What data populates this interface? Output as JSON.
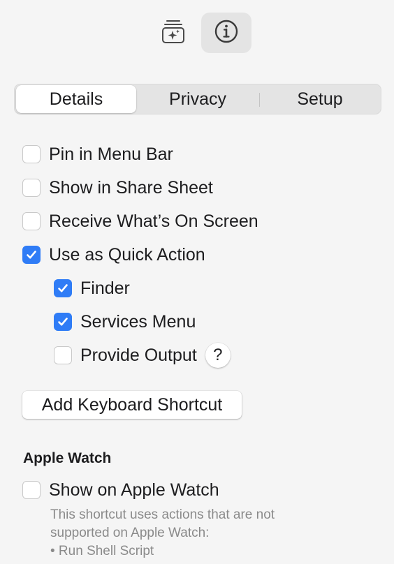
{
  "toolbar": {
    "buttons": [
      {
        "icon": "shortcut-library-icon",
        "selected": false
      },
      {
        "icon": "info-icon",
        "selected": true
      }
    ]
  },
  "tabs": {
    "items": [
      "Details",
      "Privacy",
      "Setup"
    ],
    "selected": "Details"
  },
  "options": {
    "pin_menu_bar": {
      "label": "Pin in Menu Bar",
      "checked": false
    },
    "share_sheet": {
      "label": "Show in Share Sheet",
      "checked": false
    },
    "receive_screen": {
      "label": "Receive What’s On Screen",
      "checked": false
    },
    "quick_action": {
      "label": "Use as Quick Action",
      "checked": true
    },
    "finder": {
      "label": "Finder",
      "checked": true
    },
    "services_menu": {
      "label": "Services Menu",
      "checked": true
    },
    "provide_output": {
      "label": "Provide Output",
      "checked": false
    }
  },
  "help_label": "?",
  "keyboard_shortcut_button": "Add Keyboard Shortcut",
  "apple_watch": {
    "heading": "Apple Watch",
    "show_label": "Show on Apple Watch",
    "checked": false,
    "note_line1": "This shortcut uses actions that are not",
    "note_line2": "supported on Apple Watch:",
    "note_line3": "• Run Shell Script"
  },
  "colors": {
    "accent": "#2f7cf6",
    "background": "#f5f5f5",
    "secondary_text": "#8a8a8a"
  }
}
